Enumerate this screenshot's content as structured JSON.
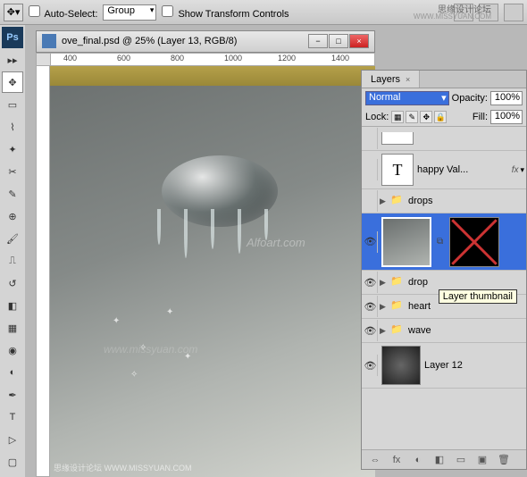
{
  "options_bar": {
    "auto_select_label": "Auto-Select:",
    "group_value": "Group",
    "show_transform_label": "Show Transform Controls"
  },
  "watermark": {
    "site_name": "思缘设计论坛",
    "url": "WWW.MISSYUAN.COM"
  },
  "document": {
    "title": "ove_final.psd @ 25% (Layer 13, RGB/8)",
    "ruler_ticks": [
      "400",
      "600",
      "800",
      "1000",
      "1200",
      "1400"
    ]
  },
  "canvas": {
    "wm_alfoart": "Alfoart.com",
    "wm_missyuan": "www.missyuan.com",
    "footer_wm": "思缘设计论坛 WWW.MISSYUAN.COM"
  },
  "layers_panel": {
    "tab_label": "Layers",
    "blend_mode": "Normal",
    "opacity_label": "Opacity:",
    "opacity_value": "100%",
    "lock_label": "Lock:",
    "fill_label": "Fill:",
    "fill_value": "100%",
    "tooltip": "Layer thumbnail",
    "layers": {
      "happy_val": {
        "label": "happy Val...",
        "fx": "fx",
        "type_glyph": "T"
      },
      "drops": {
        "label": "drops"
      },
      "drop": {
        "label": "drop"
      },
      "heart": {
        "label": "heart"
      },
      "wave": {
        "label": "wave"
      },
      "layer12": {
        "label": "Layer 12"
      }
    },
    "footer_icons": [
      "⇔",
      "fx",
      "◐",
      "◧",
      "▭",
      "▣",
      "🗑"
    ]
  }
}
